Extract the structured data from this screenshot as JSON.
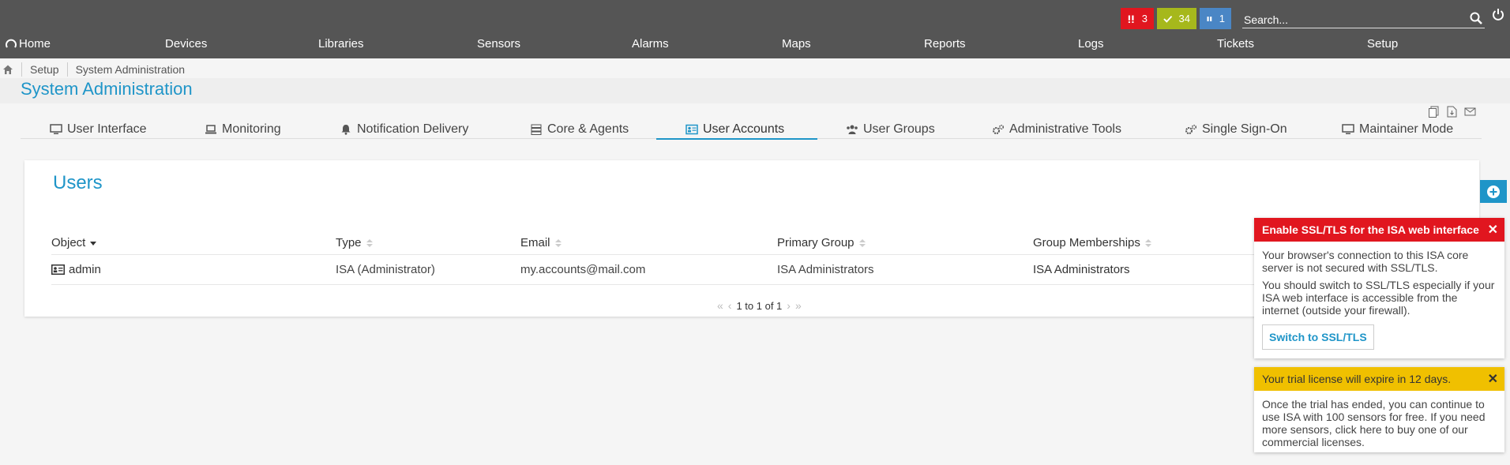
{
  "status": {
    "error_count": "3",
    "ok_count": "34",
    "paused_count": "1",
    "colors": {
      "error": "#e1161f",
      "ok": "#a6b81c",
      "paused": "#4a86c5"
    }
  },
  "search": {
    "placeholder": "Search..."
  },
  "nav": {
    "home": "Home",
    "items": [
      "Devices",
      "Libraries",
      "Sensors",
      "Alarms",
      "Maps",
      "Reports",
      "Logs",
      "Tickets",
      "Setup"
    ]
  },
  "breadcrumb": {
    "items": [
      "Setup",
      "System Administration"
    ]
  },
  "page": {
    "title": "System Administration"
  },
  "tabs": [
    {
      "label": "User Interface",
      "icon": "monitor-icon"
    },
    {
      "label": "Monitoring",
      "icon": "laptop-icon"
    },
    {
      "label": "Notification Delivery",
      "icon": "bell-icon"
    },
    {
      "label": "Core & Agents",
      "icon": "server-icon"
    },
    {
      "label": "User Accounts",
      "icon": "id-card-icon",
      "active": true
    },
    {
      "label": "User Groups",
      "icon": "users-icon"
    },
    {
      "label": "Administrative Tools",
      "icon": "gears-icon"
    },
    {
      "label": "Single Sign-On",
      "icon": "gears-icon"
    },
    {
      "label": "Maintainer Mode",
      "icon": "monitor-icon"
    }
  ],
  "users": {
    "title": "Users",
    "columns": [
      "Object",
      "Type",
      "Email",
      "Primary Group",
      "Group Memberships"
    ],
    "rows": [
      {
        "object": "admin",
        "type": "ISA (Administrator)",
        "email": "my.accounts@mail.com",
        "primary_group": "ISA Administrators",
        "memberships": "ISA Administrators"
      }
    ],
    "pager": {
      "text": "1 to 1 of 1"
    }
  },
  "notices": {
    "ssl": {
      "title": "Enable SSL/TLS for the ISA web interface",
      "p1": "Your browser's connection to this ISA core server is not secured with SSL/TLS.",
      "p2": "You should switch to SSL/TLS especially if your ISA web interface is accessible from the internet (outside your firewall).",
      "button": "Switch to SSL/TLS"
    },
    "trial": {
      "title": "Your trial license will expire in 12 days.",
      "body": "Once the trial has ended, you can continue to use ISA with 100 sensors for free. If you need more sensors, click here to buy one of our commercial licenses."
    }
  },
  "accent": "#1f95c8"
}
